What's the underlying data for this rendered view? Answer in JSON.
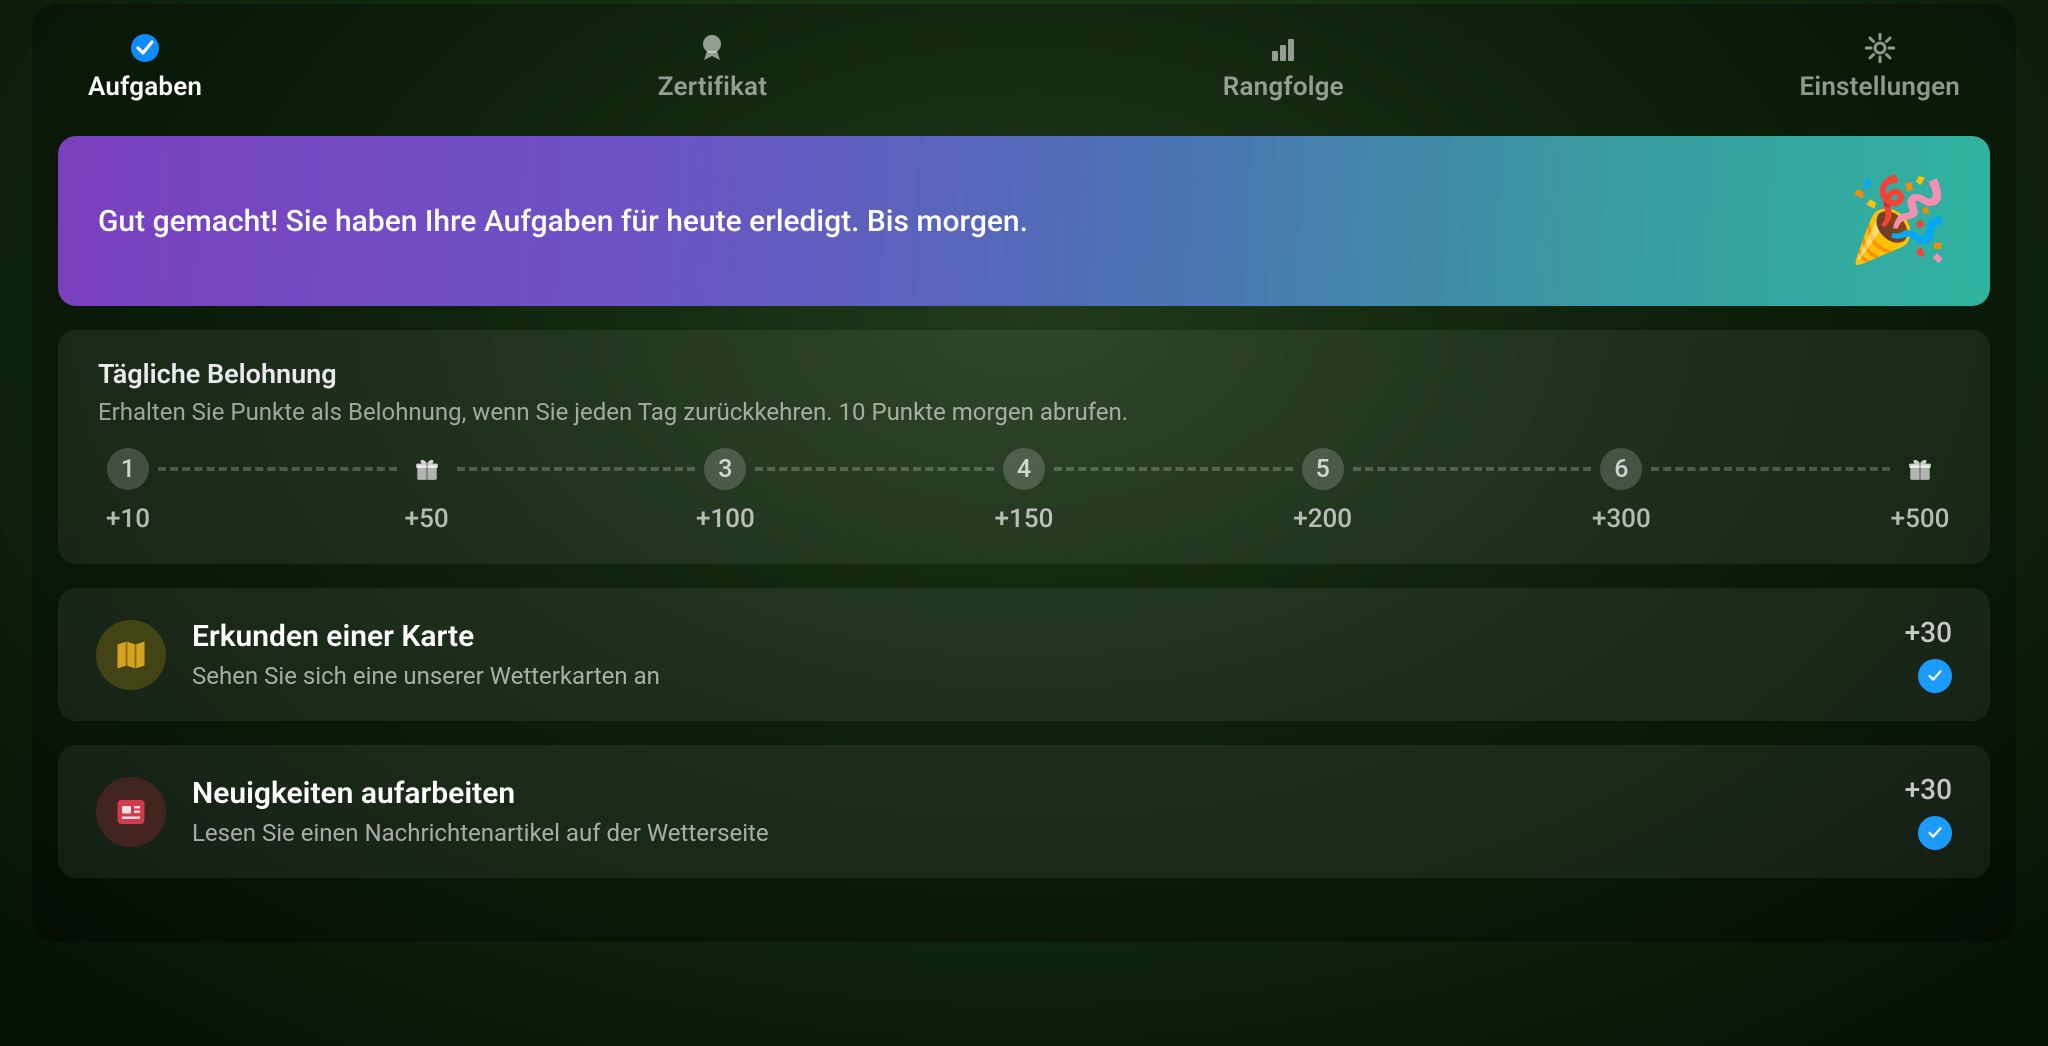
{
  "tabs": {
    "tasks": {
      "label": "Aufgaben"
    },
    "cert": {
      "label": "Zertifikat"
    },
    "rank": {
      "label": "Rangfolge"
    },
    "settings": {
      "label": "Einstellungen"
    }
  },
  "banner": {
    "text": "Gut gemacht! Sie haben Ihre Aufgaben für heute erledigt. Bis morgen.",
    "emoji": "🎉"
  },
  "daily": {
    "title": "Tägliche Belohnung",
    "subtitle": "Erhalten Sie Punkte als Belohnung, wenn Sie jeden Tag zurückkehren. 10 Punkte morgen abrufen.",
    "steps": [
      {
        "node": "1",
        "points": "+10",
        "gift": false
      },
      {
        "node": "",
        "points": "+50",
        "gift": true
      },
      {
        "node": "3",
        "points": "+100",
        "gift": false
      },
      {
        "node": "4",
        "points": "+150",
        "gift": false
      },
      {
        "node": "5",
        "points": "+200",
        "gift": false
      },
      {
        "node": "6",
        "points": "+300",
        "gift": false
      },
      {
        "node": "",
        "points": "+500",
        "gift": true
      }
    ]
  },
  "tasks": [
    {
      "icon": "map",
      "title": "Erkunden einer Karte",
      "subtitle": "Sehen Sie sich eine unserer Wetterkarten an",
      "points": "+30",
      "done": true
    },
    {
      "icon": "news",
      "title": "Neuigkeiten aufarbeiten",
      "subtitle": "Lesen Sie einen Nachrichtenartikel auf der Wetterseite",
      "points": "+30",
      "done": true
    }
  ]
}
